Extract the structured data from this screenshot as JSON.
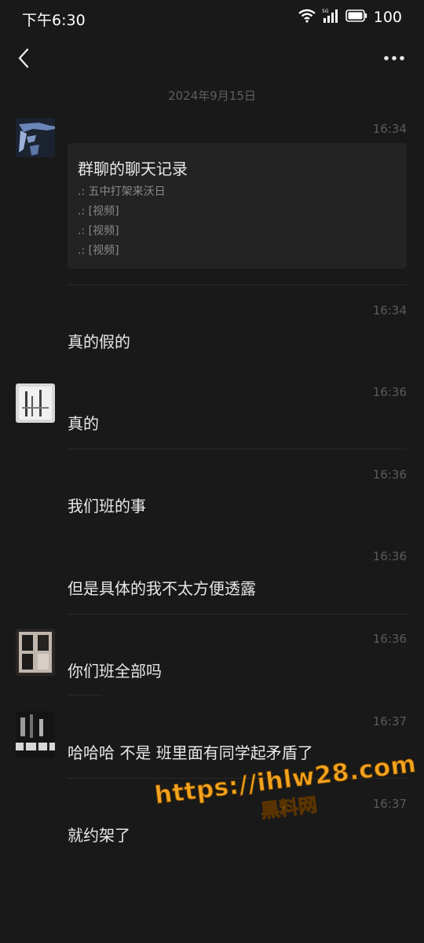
{
  "status_bar": {
    "time": "下午6:30",
    "battery": "100",
    "network": "5G"
  },
  "nav": {
    "back_icon": "chevron-left-icon",
    "more_icon": "more-dots-icon"
  },
  "date_header": "2024年9月15日",
  "forwarded_card": {
    "time": "16:34",
    "title": "群聊的聊天记录",
    "lines": [
      ".: 五中打架来沃日",
      ".: [视频]",
      ".: [视频]",
      ".: [视频]"
    ]
  },
  "messages": [
    {
      "time": "16:34",
      "text": "真的假的"
    },
    {
      "time": "16:36",
      "text": "真的"
    },
    {
      "time": "16:36",
      "text": "我们班的事"
    },
    {
      "time": "16:36",
      "text": "但是具体的我不太方便透露"
    },
    {
      "time": "16:36",
      "text": "你们班全部吗"
    },
    {
      "time": "16:37",
      "text": "哈哈哈 不是 班里面有同学起矛盾了"
    },
    {
      "time": "16:37",
      "text": "就约架了"
    }
  ],
  "watermark": {
    "url": "https://ihlw28.com",
    "name": "黑料网",
    "color": "#f3a31e"
  }
}
